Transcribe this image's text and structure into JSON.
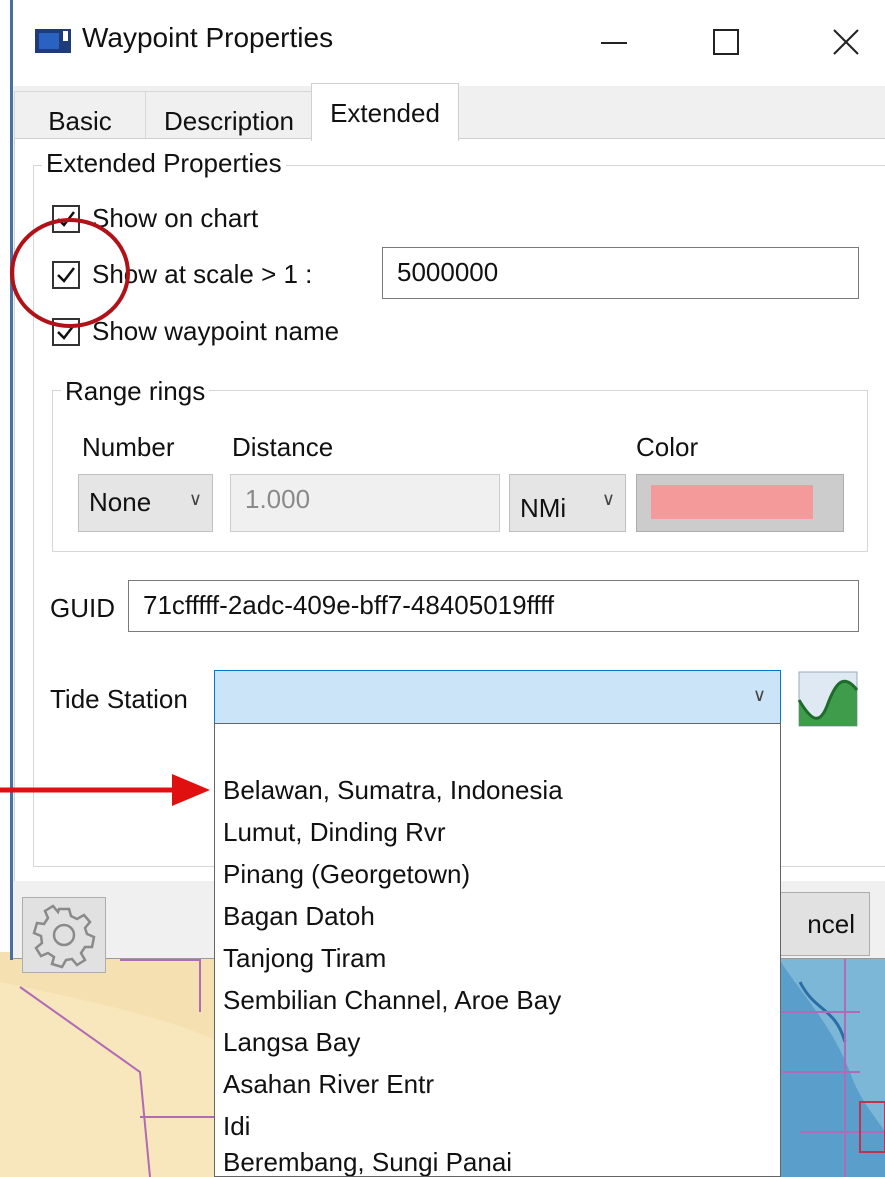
{
  "window": {
    "title": "Waypoint Properties",
    "buttons": [
      "minimize",
      "maximize",
      "close"
    ]
  },
  "tabs": [
    {
      "label": "Basic",
      "active": false
    },
    {
      "label": "Description",
      "active": false
    },
    {
      "label": "Extended",
      "active": true
    }
  ],
  "extended": {
    "group_label": "Extended Properties",
    "show_on_chart": {
      "label": "Show on chart",
      "checked": true
    },
    "show_at_scale": {
      "label": "Show at scale > 1 :",
      "checked": true,
      "value": "5000000"
    },
    "show_waypoint_name": {
      "label": "Show waypoint name",
      "checked": true
    },
    "range_rings": {
      "group_label": "Range rings",
      "number_label": "Number",
      "distance_label": "Distance",
      "color_label": "Color",
      "number_value": "None",
      "distance_value": "1.000",
      "unit_value": "NMi",
      "color_swatch": "#f59a9a"
    },
    "guid_label": "GUID",
    "guid_value": "71cfffff-2adc-409e-bff7-48405019ffff",
    "tide_station_label": "Tide Station",
    "tide_station_value": ""
  },
  "tide_stations": [
    "Belawan, Sumatra, Indonesia",
    "Lumut, Dinding Rvr",
    "Pinang (Georgetown)",
    "Bagan Datoh",
    "Tanjong Tiram",
    "Sembilian Channel, Aroe Bay",
    "Langsa Bay",
    "Asahan River Entr",
    "Idi",
    "Berembang, Sungi Panai"
  ],
  "footer": {
    "cancel_label": "ncel"
  },
  "colors": {
    "annotation_red": "#b01218",
    "accent_blue": "#0078d7",
    "combo_highlight": "#cce4f7"
  },
  "icons": [
    "app-icon",
    "gear-icon",
    "tide-graph-icon",
    "chevron-down-icon",
    "checkmark-icon"
  ]
}
